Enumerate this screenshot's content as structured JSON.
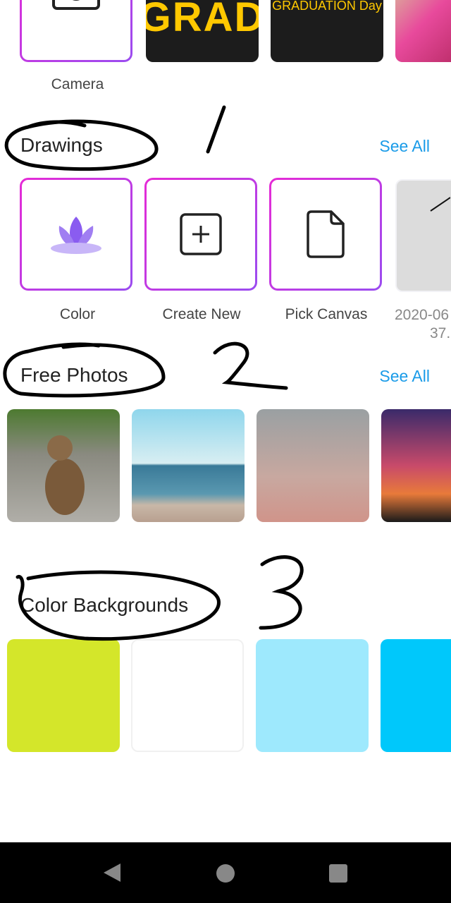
{
  "top_row": {
    "items": [
      {
        "label": "Camera",
        "icon": "camera-icon"
      },
      {
        "label": "",
        "text": "GRAD"
      },
      {
        "label": "",
        "text": "GRADUATION Day"
      },
      {
        "label": ""
      }
    ]
  },
  "drawings": {
    "title": "Drawings",
    "see_all": "See All",
    "items": [
      {
        "label": "Color",
        "icon": "lotus-icon"
      },
      {
        "label": "Create New",
        "icon": "plus-square-icon"
      },
      {
        "label": "Pick Canvas",
        "icon": "file-icon"
      },
      {
        "label": "2020-06",
        "label2": "37."
      }
    ]
  },
  "free_photos": {
    "title": "Free Photos",
    "see_all": "See All"
  },
  "color_backgrounds": {
    "title": "Color Backgrounds",
    "colors": [
      "#d4e62a",
      "#ffffff",
      "#9ee9fd",
      "#00c8fb"
    ]
  },
  "annotations": [
    "1",
    "2",
    "3"
  ],
  "colors": {
    "accent": "#1a9be8",
    "tile_border": "#b04ae8"
  }
}
